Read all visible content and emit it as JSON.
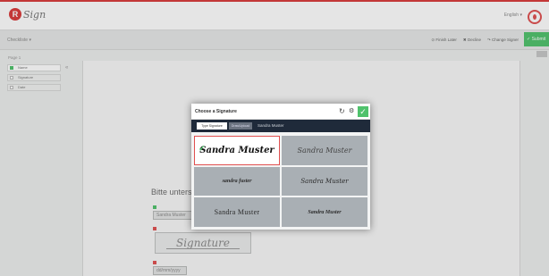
{
  "header": {
    "logo_letter": "R",
    "logo_text": "Sign",
    "language": "English ▾"
  },
  "subbar": {
    "checklist_title": "Checkliste ▾",
    "actions": [
      "⊙ Finish Later",
      "✖ Decline",
      "↷ Change Signer"
    ],
    "submit_label": "✓ Submit"
  },
  "sidebar": {
    "page_label": "Page 1",
    "collapse": "«",
    "items": [
      {
        "label": "Name",
        "active": true
      },
      {
        "label": "Signature",
        "active": false
      },
      {
        "label": "Date",
        "active": false
      }
    ]
  },
  "document": {
    "prompt_text": "Bitte untersc",
    "name_field": "Sandra Muster",
    "signature_placeholder": "Signature",
    "date_field": "dd/mm/yyyy"
  },
  "modal": {
    "title": "Choose a Signature",
    "reset_icon": "↻",
    "gear_icon": "⚙",
    "ok_icon": "✓",
    "tabs": {
      "type": "Type Signature",
      "hand": "Draw/Upload",
      "name": "Sandra Muster"
    },
    "options": [
      "Sandra Muster",
      "Sandra Muster",
      "sandra fuster",
      "Sandra Muster",
      "Sandra Muster",
      "Sandra Muster"
    ],
    "selected_index": 0
  },
  "colors": {
    "brand_red": "#d93a3a",
    "accent_green": "#4fc26c",
    "modal_tabbar": "#1f2a3a"
  }
}
